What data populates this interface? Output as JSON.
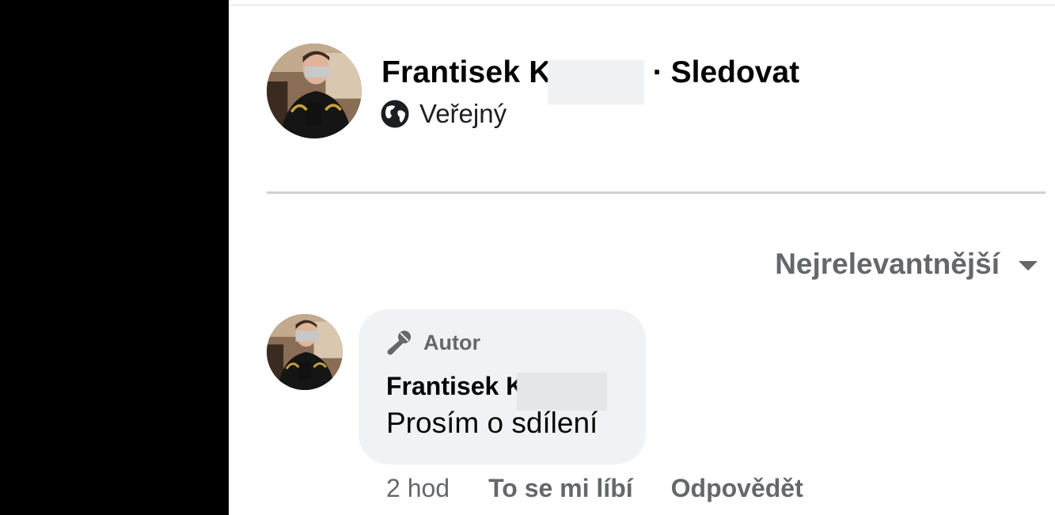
{
  "post": {
    "author_name": "Frantisek K",
    "separator": "·",
    "follow_label": "Sledovat",
    "privacy_label": "Veřejný",
    "privacy_icon": "globe-icon"
  },
  "sort": {
    "label": "Nejrelevantnější",
    "icon": "caret-down-icon"
  },
  "comment": {
    "badge_icon": "microphone-icon",
    "badge_label": "Autor",
    "author_name": "Frantisek K",
    "text": "Prosím o sdílení",
    "time": "2 hod",
    "like_label": "To se mi líbí",
    "reply_label": "Odpovědět"
  },
  "colors": {
    "text_primary": "#050505",
    "text_secondary": "#65676b",
    "bubble_bg": "#f0f2f5",
    "divider": "#ced0d4"
  }
}
